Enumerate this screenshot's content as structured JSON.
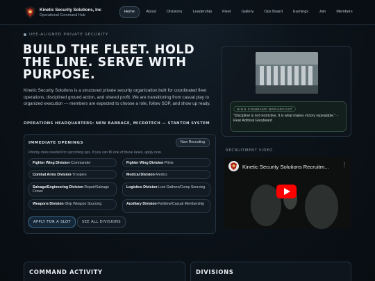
{
  "header": {
    "brand_name": "Kinetic Security Solutions, Inc",
    "brand_sub": "Operational Command Hub",
    "logo_icon": "ksi-emblem",
    "nav": [
      "Home",
      "About",
      "Divisions",
      "Leadership",
      "Fleet",
      "Gallery",
      "Ops Board",
      "Earnings",
      "Join",
      "Members"
    ],
    "active_nav": "Home"
  },
  "hero": {
    "eyebrow": "UEE-ALIGNED PRIVATE SECURITY",
    "title": "BUILD THE FLEET. HOLD THE LINE. SERVE WITH PURPOSE.",
    "body": "Kinetic Security Solutions is a structured private security organization built for coordinated fleet operations, disciplined ground action, and shared profit. We are transitioning from casual play to organized execution — members are expected to choose a role, follow SOP, and show up ready.",
    "hq": "OPERATIONS HEADQUARTERS: NEW BABBAGE, MICROTECH — STANTON SYSTEM"
  },
  "openings": {
    "title": "IMMEDIATE OPENINGS",
    "badge": "Now Recruiting",
    "subtitle": "Priority roles needed for upcoming ops. If you can fill one of these lanes, apply now.",
    "roles": [
      {
        "division": "Fighter Wing Division",
        "role": "-Commander"
      },
      {
        "division": "Fighter Wing Division",
        "role": "-Pilots"
      },
      {
        "division": "Combat Arms Division",
        "role": "-Troopers"
      },
      {
        "division": "Medical Division",
        "role": "-Medics"
      },
      {
        "division": "Salvage/Engineering Division",
        "role": "-Repair/Salvage Crews"
      },
      {
        "division": "Logistics Division",
        "role": "-Loot Gathers/Comp Sourcing"
      },
      {
        "division": "Weapons Division",
        "role": "-Ship Weapon Sourcing"
      },
      {
        "division": "Auxiliary Division",
        "role": "-Parttime/Casual Membership"
      }
    ],
    "apply_label": "APPLY FOR A SLOT",
    "see_all_label": "SEE ALL DIVISIONS"
  },
  "broadcast": {
    "label": "HIGH COMMAND BROADCAST",
    "quote": "\"Discipline is not restrictive. It is what makes victory repeatable.\" - Rear Admiral Greybeard"
  },
  "video": {
    "section_label": "RECRUITMENT VIDEO",
    "title": "Kinetic Security Solutions Recruitm...",
    "menu_icon": "kebab-menu-icon",
    "play_icon": "play-icon"
  },
  "panels": {
    "left_title": "COMMAND ACTIVITY",
    "right_title": "DIVISIONS"
  },
  "colors": {
    "background": "#0c131a",
    "accent": "#3c6a8c",
    "broadcast_green": "#2f4a3e",
    "youtube_red": "#ff0000"
  }
}
